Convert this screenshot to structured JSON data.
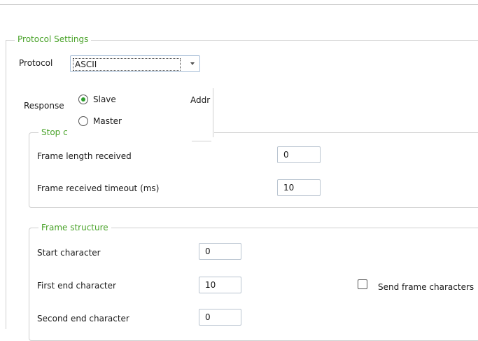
{
  "protocol_settings": {
    "legend": "Protocol Settings",
    "protocol_label": "Protocol",
    "protocol_value": "ASCII",
    "response_label": "Response",
    "response_options": [
      "Slave",
      "Master"
    ],
    "response_selected": "Slave",
    "address_label_partial": "Addr"
  },
  "stop_condition": {
    "legend_partial": "Stop c",
    "frame_length_label": "Frame length received",
    "frame_length_value": "0",
    "frame_timeout_label": "Frame received timeout (ms)",
    "frame_timeout_value": "10"
  },
  "frame_structure": {
    "legend": "Frame structure",
    "start_char_label": "Start character",
    "start_char_value": "0",
    "first_end_label": "First end character",
    "first_end_value": "10",
    "second_end_label": "Second end character",
    "second_end_value": "0",
    "send_frame_label": "Send frame characters",
    "send_frame_checked": false
  },
  "colors": {
    "accent": "#4aa32a",
    "radio_dot": "#2e9f2e"
  }
}
